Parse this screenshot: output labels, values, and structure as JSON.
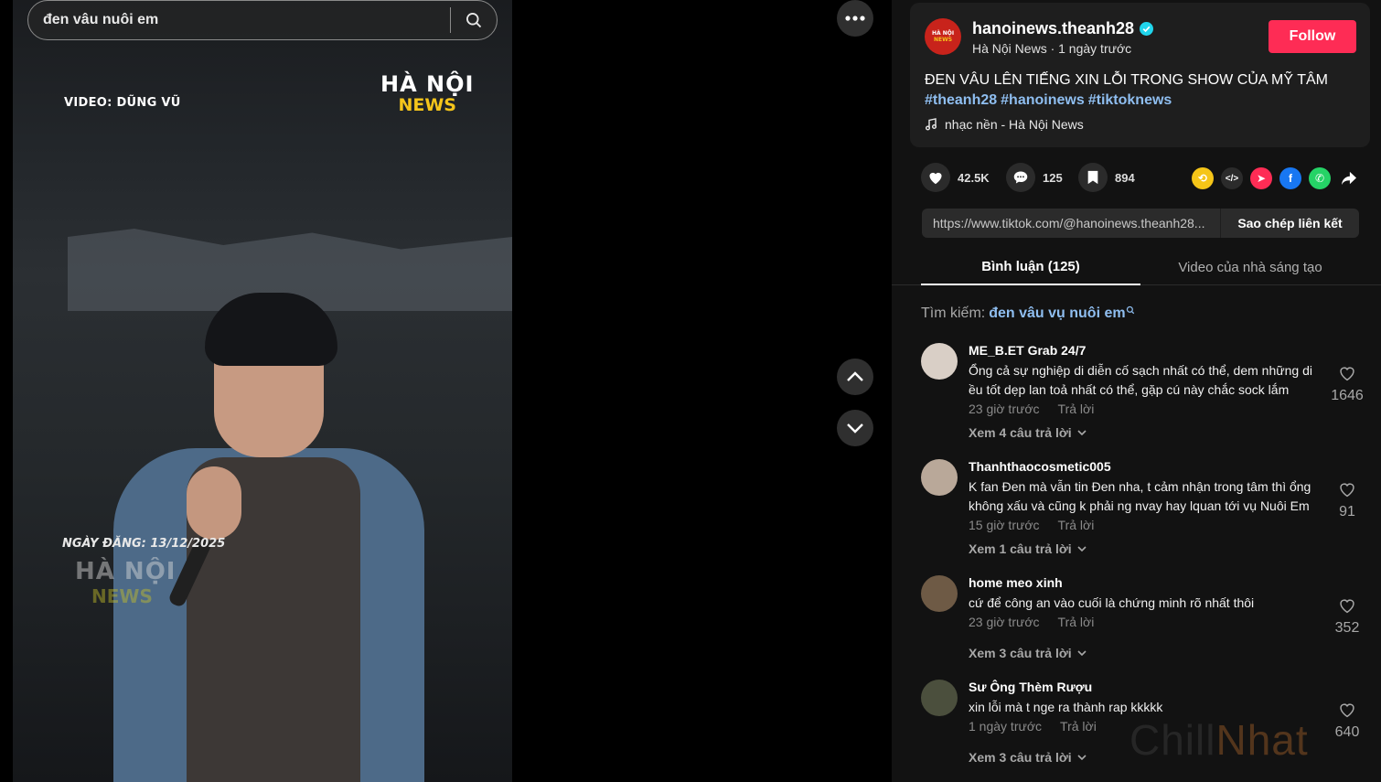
{
  "search": {
    "query": "đen vâu nuôi em"
  },
  "video": {
    "credit": "VIDEO: DŨNG VŨ",
    "brand_line1": "HÀ NỘI",
    "brand_line2": "NEWS",
    "date_label": "NGÀY ĐĂNG: 13/12/2025",
    "watermark_line1": "HÀ NỘI",
    "watermark_line2": "NEWS"
  },
  "author": {
    "avatar_text1": "HÀ NỘI",
    "avatar_text2": "NEWS",
    "username": "hanoinews.theanh28",
    "meta": "Hà Nội News · 1 ngày trước",
    "follow_label": "Follow"
  },
  "post": {
    "caption": "ĐEN VÂU LÊN TIẾNG XIN LỖI TRONG SHOW CỦA MỸ TÂM",
    "hashtags": [
      "#theanh28",
      "#hanoinews",
      "#tiktoknews"
    ],
    "music": "nhạc nền - Hà Nội News"
  },
  "stats": {
    "likes": "42.5K",
    "comments": "125",
    "saves": "894"
  },
  "share": {
    "url": "https://www.tiktok.com/@hanoinews.theanh28...",
    "copy_label": "Sao chép liên kết"
  },
  "tabs": {
    "comments": "Bình luận (125)",
    "creator_videos": "Video của nhà sáng tạo"
  },
  "search_hint": {
    "label": "Tìm kiếm:",
    "query": "đen vâu vụ nuôi em"
  },
  "comments": [
    {
      "user": "ME_B.ET Grab 24/7",
      "text": "Ổng cả sự nghiệp di diễn cố sạch nhất có thể, dem những di ều tốt dẹp lan toả nhất có thể, gặp cú này chắc sock lắm",
      "time": "23 giờ trước",
      "reply": "Trả lời",
      "more": "Xem 4 câu trả lời",
      "likes": "1646",
      "avatar_color": "#d9cfc6"
    },
    {
      "user": "Thanhthaocosmetic005",
      "text": "K fan Đen mà vẫn tin Đen nha, t cảm nhận trong tâm thì ổng không xấu và cũng k phải ng nvay hay lquan tới vụ Nuôi Em",
      "time": "15 giờ trước",
      "reply": "Trả lời",
      "more": "Xem 1 câu trả lời",
      "likes": "91",
      "avatar_color": "#b9a899"
    },
    {
      "user": "home meo xinh",
      "text": "cứ để công an vào cuối là chứng minh rõ nhất thôi",
      "time": "23 giờ trước",
      "reply": "Trả lời",
      "more": "Xem 3 câu trả lời",
      "likes": "352",
      "avatar_color": "#6e5a45"
    },
    {
      "user": "Sư Ông Thèm Rượu",
      "text": "xin lỗi mà t nge ra thành rap kkkkk",
      "time": "1 ngày trước",
      "reply": "Trả lời",
      "more": "Xem 3 câu trả lời",
      "likes": "640",
      "avatar_color": "#4b4f3d"
    }
  ],
  "overlay_watermark": {
    "part1": "Chill",
    "part2": "Nhat"
  }
}
